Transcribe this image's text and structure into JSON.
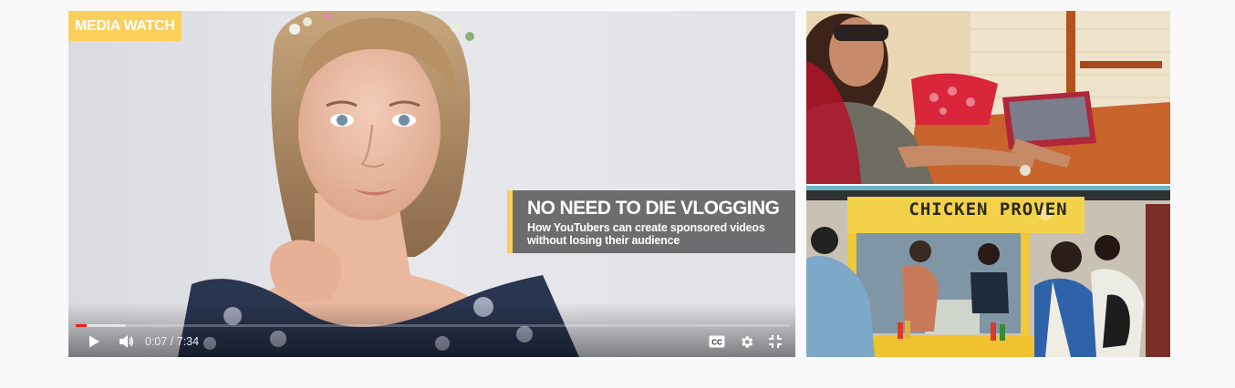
{
  "main_video": {
    "badge": "MEDIA WATCH",
    "lower_third": {
      "title": "NO NEED TO DIE VLOGGING",
      "subtitle_line1": "How YouTubers can create sponsored videos",
      "subtitle_line2": "without losing their audience"
    },
    "player": {
      "time": "0:07 / 7:34",
      "played_fraction": 0.015,
      "buffered_fraction": 0.07,
      "state": "paused"
    }
  },
  "side_thumbnails": [
    {
      "id": "woman-tablet-cafe"
    },
    {
      "id": "street-food-stall",
      "sign_text": "CHICKEN PROVEN"
    }
  ],
  "colors": {
    "accent": "#fbcf5b",
    "progress": "#e62117",
    "page_bg": "#f9f9f9"
  },
  "icons": [
    "play-icon",
    "volume-icon",
    "captions-icon",
    "settings-gear-icon",
    "exit-fullscreen-icon"
  ]
}
